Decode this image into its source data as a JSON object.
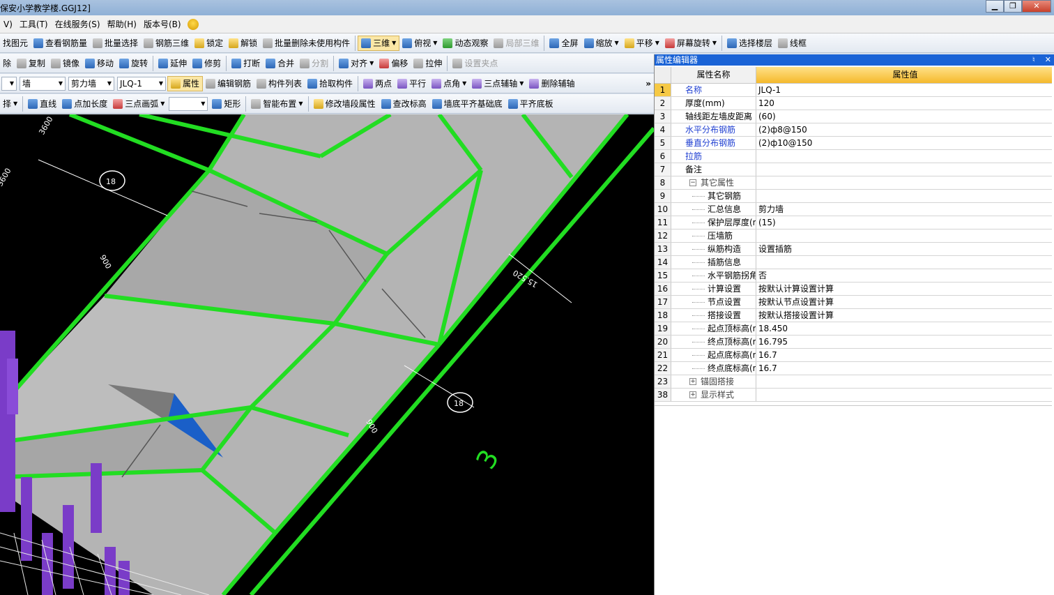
{
  "window": {
    "title": "保安小学教学楼.GGJ12]",
    "buttons": [
      "▁",
      "❐",
      "✕"
    ]
  },
  "menu": [
    "V)",
    "工具(T)",
    "在线服务(S)",
    "帮助(H)",
    "版本号(B)"
  ],
  "toolbar1": [
    "找图元",
    "查看钢筋量",
    "批量选择",
    "钢筋三维",
    "锁定",
    "解锁",
    "批量删除未使用构件",
    "三维",
    "俯视",
    "动态观察",
    "局部三维",
    "全屏",
    "缩放",
    "平移",
    "屏幕旋转",
    "选择楼层",
    "线框"
  ],
  "toolbar2": [
    "除",
    "复制",
    "镜像",
    "移动",
    "旋转",
    "延伸",
    "修剪",
    "打断",
    "合并",
    "分割",
    "对齐",
    "偏移",
    "拉伸",
    "设置夹点"
  ],
  "toolbar3": {
    "combo1": "",
    "combo2": "墙",
    "combo3": "剪力墙",
    "combo4": "JLQ-1",
    "buttons": [
      "属性",
      "编辑钢筋",
      "构件列表",
      "拾取构件",
      "两点",
      "平行",
      "点角",
      "三点辅轴",
      "删除辅轴"
    ],
    "more": "»"
  },
  "toolbar4": [
    "择",
    "直线",
    "点加长度",
    "三点画弧",
    "",
    "矩形",
    "智能布置",
    "修改墙段属性",
    "查改标高",
    "墙底平齐基础底",
    "平齐底板"
  ],
  "viewport": {
    "dims": [
      "3600",
      "3600",
      "900",
      "900",
      "15.520"
    ],
    "axis_bubbles": [
      "18",
      "18"
    ],
    "axis_number": "3"
  },
  "prop_editor": {
    "title": "属性编辑器",
    "header_buttons": [
      "♮",
      "✕"
    ],
    "col_name": "属性名称",
    "col_value": "属性值",
    "rows": [
      {
        "num": "1",
        "name": "名称",
        "value": "JLQ-1"
      },
      {
        "num": "2",
        "name": "厚度(mm)",
        "value": "120"
      },
      {
        "num": "3",
        "name": "轴线距左墙皮距离",
        "value": "(60)"
      },
      {
        "num": "4",
        "name": "水平分布钢筋",
        "value": "(2)ф8@150"
      },
      {
        "num": "5",
        "name": "垂直分布钢筋",
        "value": "(2)ф10@150"
      },
      {
        "num": "6",
        "name": "拉筋",
        "value": ""
      },
      {
        "num": "7",
        "name": "备注",
        "value": ""
      },
      {
        "num": "8",
        "name": "其它属性",
        "value": ""
      },
      {
        "num": "9",
        "name": "其它钢筋",
        "value": ""
      },
      {
        "num": "10",
        "name": "汇总信息",
        "value": "剪力墙"
      },
      {
        "num": "11",
        "name": "保护层厚度(mm)",
        "value": "(15)"
      },
      {
        "num": "12",
        "name": "压墙筋",
        "value": ""
      },
      {
        "num": "13",
        "name": "纵筋构造",
        "value": "设置插筋"
      },
      {
        "num": "14",
        "name": "插筋信息",
        "value": ""
      },
      {
        "num": "15",
        "name": "水平钢筋拐角增",
        "value": "否"
      },
      {
        "num": "16",
        "name": "计算设置",
        "value": "按默认计算设置计算"
      },
      {
        "num": "17",
        "name": "节点设置",
        "value": "按默认节点设置计算"
      },
      {
        "num": "18",
        "name": "搭接设置",
        "value": "按默认搭接设置计算"
      },
      {
        "num": "19",
        "name": "起点顶标高(m)",
        "value": "18.450"
      },
      {
        "num": "20",
        "name": "终点顶标高(m)",
        "value": "16.795"
      },
      {
        "num": "21",
        "name": "起点底标高(m)",
        "value": "16.7"
      },
      {
        "num": "22",
        "name": "终点底标高(m)",
        "value": "16.7"
      },
      {
        "num": "23",
        "name": "锚固搭接",
        "value": ""
      },
      {
        "num": "38",
        "name": "显示样式",
        "value": ""
      }
    ],
    "expanders": {
      "collapse": "−",
      "expand": "+"
    }
  },
  "colors": {
    "wall_green": "#22dd22",
    "surface_gray": "#b4b4b4",
    "column_purple": "#7a3cc8",
    "header_blue": "#1a63d6",
    "value_header": "#f5b92c"
  }
}
